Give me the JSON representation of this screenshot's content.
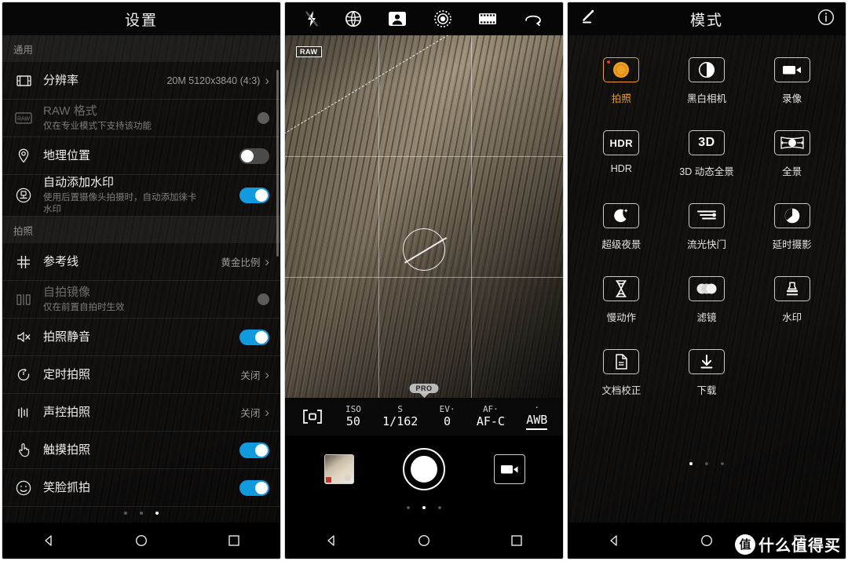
{
  "settings": {
    "title": "设置",
    "sections": [
      {
        "header": "通用",
        "rows": [
          {
            "icon": "resolution-icon",
            "label": "分辨率",
            "sub": "",
            "value": "20M 5120x3840 (4:3)",
            "control": "chevron",
            "disabled": false
          },
          {
            "icon": "raw-icon",
            "label": "RAW 格式",
            "sub": "仅在专业模式下支持该功能",
            "value": "",
            "control": "toggle-disabled",
            "disabled": true
          },
          {
            "icon": "location-icon",
            "label": "地理位置",
            "sub": "",
            "value": "",
            "control": "toggle-off",
            "disabled": false
          },
          {
            "icon": "watermark-icon",
            "label": "自动添加水印",
            "sub": "使用后置摄像头拍摄时，自动添加徕卡水印",
            "value": "",
            "control": "toggle-on",
            "disabled": false
          }
        ]
      },
      {
        "header": "拍照",
        "rows": [
          {
            "icon": "grid-icon",
            "label": "参考线",
            "sub": "",
            "value": "黄金比例",
            "control": "chevron",
            "disabled": false
          },
          {
            "icon": "mirror-icon",
            "label": "自拍镜像",
            "sub": "仅在前置自拍时生效",
            "value": "",
            "control": "toggle-disabled",
            "disabled": true
          },
          {
            "icon": "mute-icon",
            "label": "拍照静音",
            "sub": "",
            "value": "",
            "control": "toggle-on",
            "disabled": false
          },
          {
            "icon": "timer-icon",
            "label": "定时拍照",
            "sub": "",
            "value": "关闭",
            "control": "chevron",
            "disabled": false
          },
          {
            "icon": "audio-icon",
            "label": "声控拍照",
            "sub": "",
            "value": "关闭",
            "control": "chevron",
            "disabled": false
          },
          {
            "icon": "touch-icon",
            "label": "触摸拍照",
            "sub": "",
            "value": "",
            "control": "toggle-on",
            "disabled": false
          },
          {
            "icon": "smile-icon",
            "label": "笑脸抓拍",
            "sub": "",
            "value": "",
            "control": "toggle-on",
            "disabled": false
          }
        ]
      }
    ],
    "page_dots": {
      "count": 3,
      "active": 2
    }
  },
  "camera": {
    "top_icons": [
      "flash-off-icon",
      "aperture-icon",
      "portrait-icon",
      "moving-picture-icon",
      "filmstrip-icon",
      "loop-icon"
    ],
    "raw_badge": "RAW",
    "pro_tab": "PRO",
    "pro_bar": [
      {
        "key": "metering-icon",
        "value": ""
      },
      {
        "key": "ISO",
        "value": "50"
      },
      {
        "key": "S",
        "value": "1/162"
      },
      {
        "key": "EV·",
        "value": "0"
      },
      {
        "key": "AF·",
        "value": "AF-C"
      },
      {
        "key": "·",
        "value": "AWB"
      }
    ],
    "thumbnail": "gallery-thumbnail",
    "shutter": "shutter-button",
    "video": "video-record-button",
    "page_dots": {
      "count": 3,
      "active": 1
    }
  },
  "modes": {
    "title": "模式",
    "edit_icon": "edit-pencil-icon",
    "info_icon": "info-icon",
    "items": [
      {
        "glyph": "camera-dot-icon",
        "label": "拍照",
        "selected": true
      },
      {
        "glyph": "monochrome-icon",
        "label": "黑白相机",
        "selected": false
      },
      {
        "glyph": "video-icon",
        "label": "录像",
        "selected": false
      },
      {
        "glyph": "HDR",
        "label": "HDR",
        "selected": false
      },
      {
        "glyph": "3D",
        "label": "3D 动态全景",
        "selected": false
      },
      {
        "glyph": "panorama-icon",
        "label": "全景",
        "selected": false
      },
      {
        "glyph": "night-icon",
        "label": "超级夜景",
        "selected": false
      },
      {
        "glyph": "lightpainting-icon",
        "label": "流光快门",
        "selected": false
      },
      {
        "glyph": "timelapse-icon",
        "label": "延时摄影",
        "selected": false
      },
      {
        "glyph": "slowmotion-icon",
        "label": "慢动作",
        "selected": false
      },
      {
        "glyph": "filter-icon",
        "label": "滤镜",
        "selected": false
      },
      {
        "glyph": "stamp-icon",
        "label": "水印",
        "selected": false
      },
      {
        "glyph": "document-icon",
        "label": "文档校正",
        "selected": false
      },
      {
        "glyph": "download-icon",
        "label": "下载",
        "selected": false
      }
    ],
    "page_dots": {
      "count": 3,
      "active": 0
    }
  },
  "nav": {
    "back": "back-icon",
    "home": "home-icon",
    "recents": "recents-icon"
  },
  "watermark": {
    "badge": "值",
    "text": "什么值得买"
  },
  "colors": {
    "accent_blue": "#129adf",
    "accent_orange": "#f0a020",
    "red_dot": "#e0352b"
  }
}
